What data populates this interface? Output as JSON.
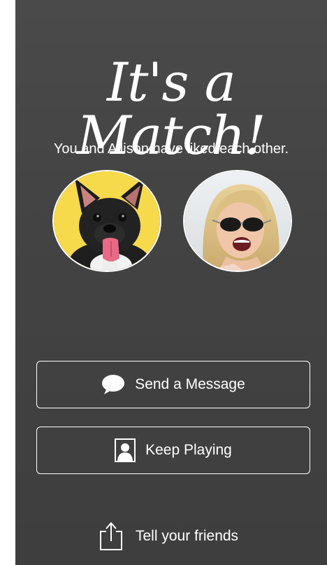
{
  "match": {
    "title": "It's a Match!",
    "subtitle": "You and Allison have liked each other."
  },
  "avatars": {
    "user": {
      "icon": "bulldog-photo",
      "background": "#f7d94c"
    },
    "match": {
      "icon": "allison-photo",
      "border": "#ffffff"
    }
  },
  "actions": {
    "send_message": "Send a Message",
    "keep_playing": "Keep Playing",
    "tell_friends": "Tell your friends"
  },
  "icons": {
    "send_message": "speech-bubble-icon",
    "keep_playing": "profile-card-icon",
    "tell_friends": "share-icon"
  }
}
